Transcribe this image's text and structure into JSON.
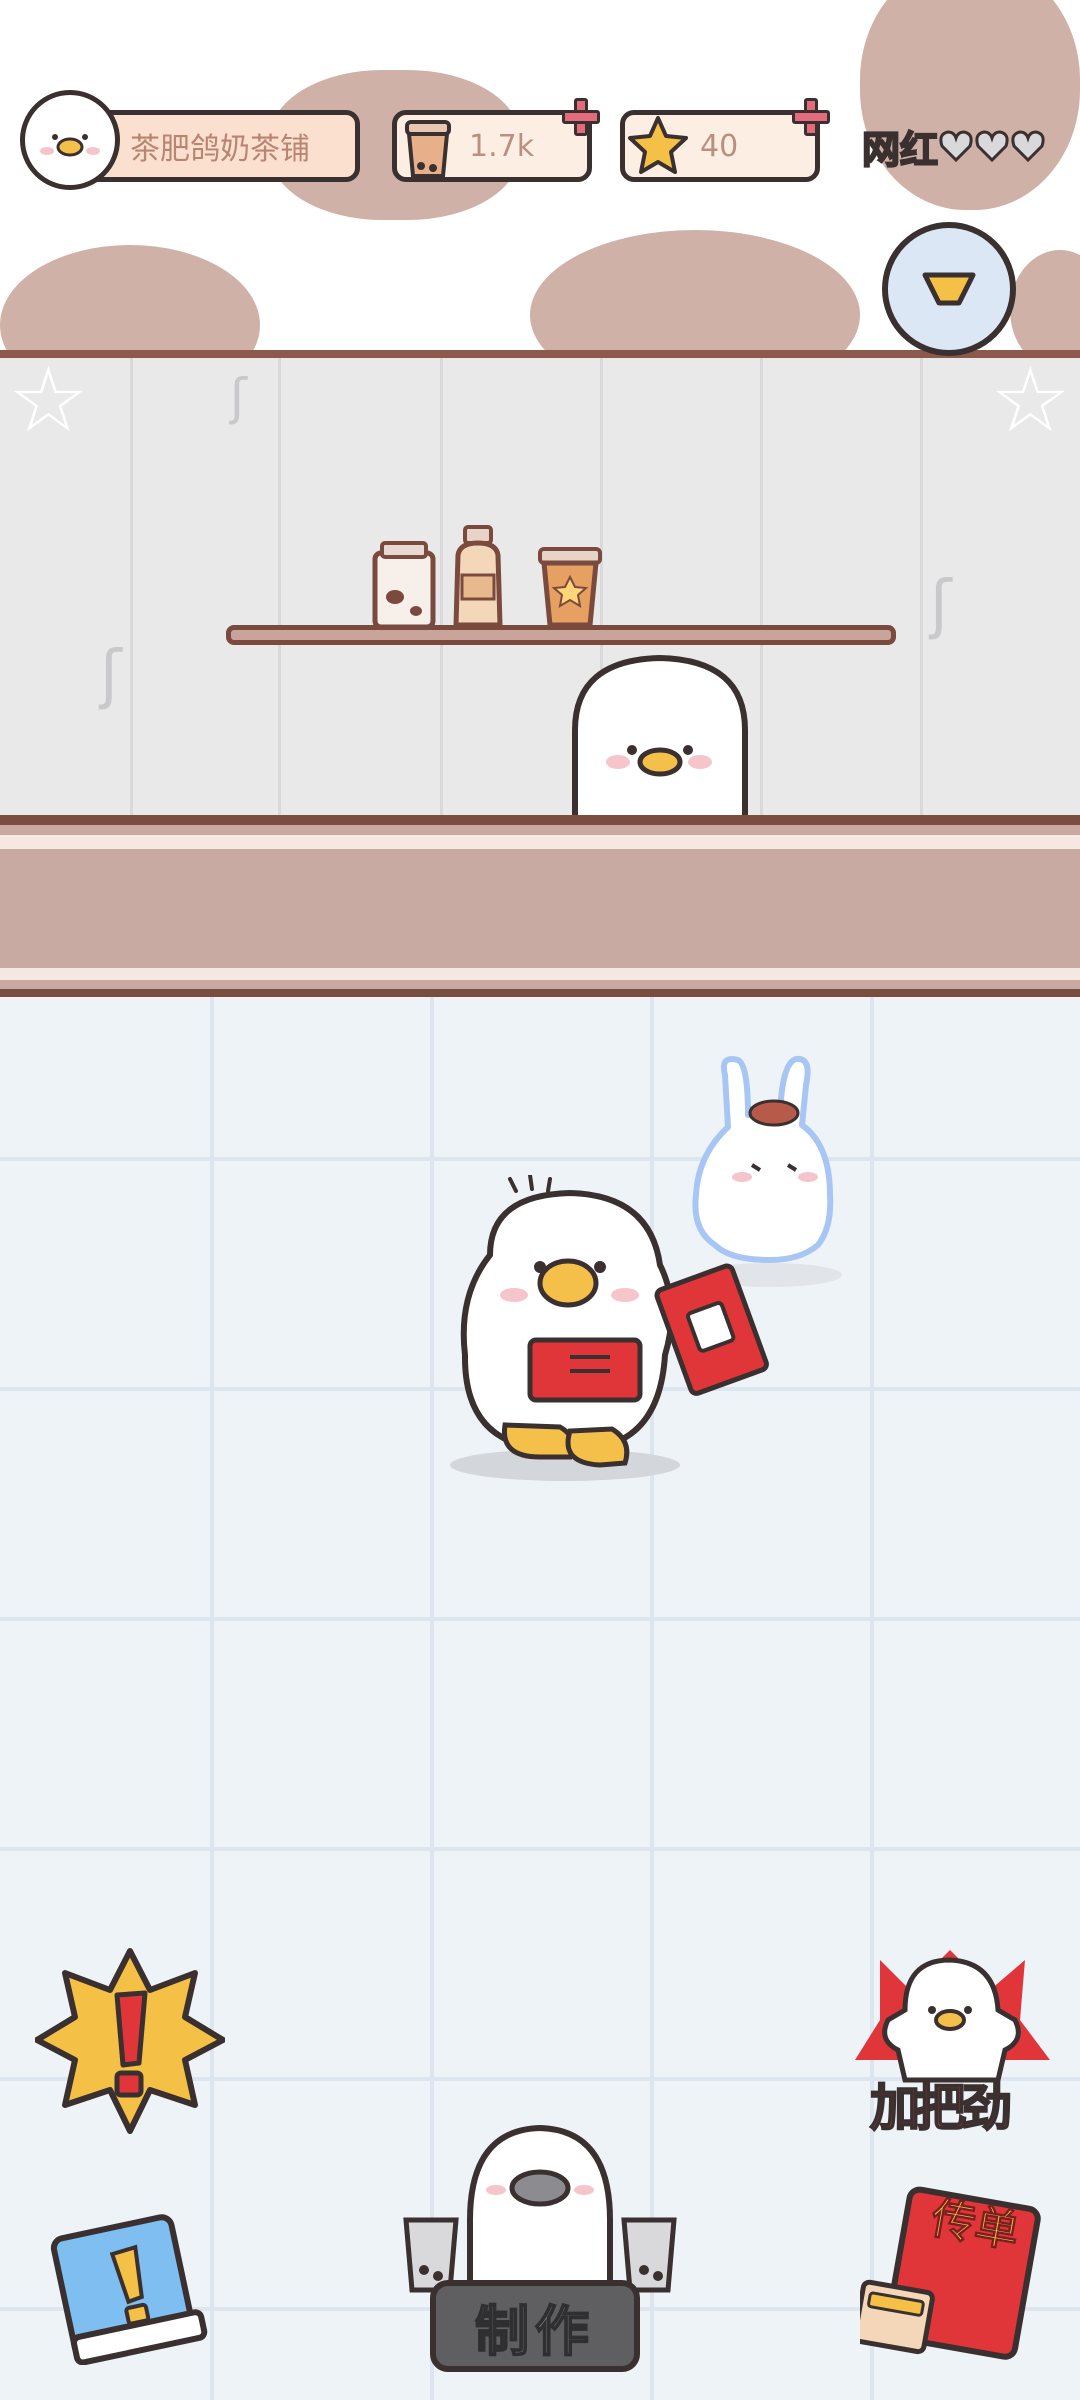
{
  "hud": {
    "shop_name": "茶肥鸽奶茶铺",
    "cups": "1.7k",
    "stars": "40",
    "fame_label": "网红",
    "fame_hearts_filled": 0,
    "fame_hearts_total": 3
  },
  "buttons": {
    "make_label": "制作",
    "cheer_label": "加把劲",
    "flyer_label": "传单",
    "alert_icon": "exclamation-icon",
    "guide_icon": "book-icon",
    "dropdown_icon": "chevron-down-icon"
  },
  "colors": {
    "wall": "#e9e9ea",
    "counter": "#c8aaa2",
    "floor": "#eef3f8",
    "accent_red": "#e0363a",
    "accent_yellow": "#f4c046",
    "pill_bg": "#fdeee4"
  }
}
